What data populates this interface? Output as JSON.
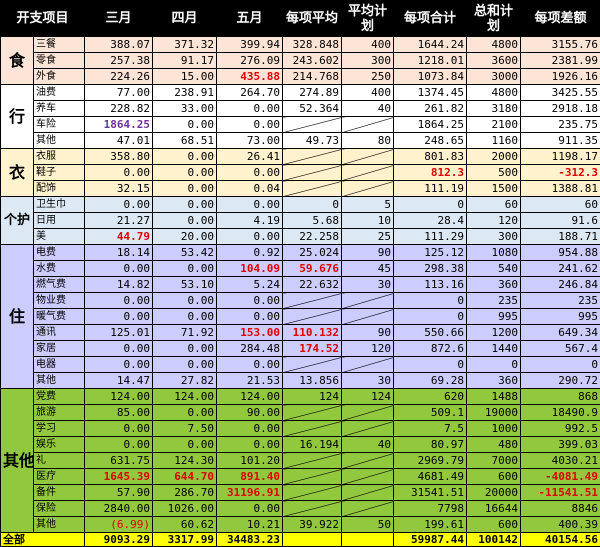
{
  "headers": {
    "category": "开支项目",
    "march": "三月",
    "april": "四月",
    "may": "五月",
    "per_avg": "每项平均",
    "avg_plan": "平均计划",
    "per_total": "每项合计",
    "sum_plan": "总和计划",
    "per_diff": "每项差额"
  },
  "colors": {
    "header_bg": "#000000",
    "food": "#fce4d6",
    "transport": "#ffffff",
    "clothing": "#fff2cc",
    "personal_care": "#dde8f5",
    "housing": "#ccccff",
    "other": "#92c83e",
    "total": "#ffff00",
    "negative_red": "#e00000",
    "purple": "#7030a0"
  },
  "groups": [
    {
      "category": "食",
      "color": "#fce4d6",
      "rows": [
        {
          "item": "三餐",
          "m3": "388.07",
          "m4": "371.32",
          "m5": "399.94",
          "avg": "328.848",
          "avg_plan": "400",
          "total": "1644.24",
          "plan": "4800",
          "diff": "3155.76"
        },
        {
          "item": "零食",
          "m3": "257.38",
          "m4": "91.17",
          "m5": "276.09",
          "avg": "243.602",
          "avg_plan": "300",
          "total": "1218.01",
          "plan": "3600",
          "diff": "2381.99"
        },
        {
          "item": "外食",
          "m3": "224.26",
          "m4": "15.00",
          "m5": "435.88",
          "avg": "214.768",
          "avg_plan": "250",
          "total": "1073.84",
          "plan": "3000",
          "diff": "1926.16",
          "red": [
            "m5"
          ]
        }
      ]
    },
    {
      "category": "行",
      "color": "#ffffff",
      "rows": [
        {
          "item": "油费",
          "m3": "77.00",
          "m4": "238.91",
          "m5": "264.70",
          "avg": "274.89",
          "avg_plan": "400",
          "total": "1374.45",
          "plan": "4800",
          "diff": "3425.55"
        },
        {
          "item": "养车",
          "m3": "228.82",
          "m4": "33.00",
          "m5": "0.00",
          "avg": "52.364",
          "avg_plan": "40",
          "total": "261.82",
          "plan": "3180",
          "diff": "2918.18"
        },
        {
          "item": "车险",
          "m3": "1864.25",
          "m4": "0.00",
          "m5": "0.00",
          "avg": "",
          "avg_plan": "",
          "total": "1864.25",
          "plan": "2100",
          "diff": "235.75",
          "purple": [
            "m3"
          ],
          "slash": [
            "avg",
            "avg_plan"
          ]
        },
        {
          "item": "其他",
          "m3": "47.01",
          "m4": "68.51",
          "m5": "73.00",
          "avg": "49.73",
          "avg_plan": "80",
          "total": "248.65",
          "plan": "1160",
          "diff": "911.35"
        }
      ]
    },
    {
      "category": "衣",
      "color": "#fff2cc",
      "rows": [
        {
          "item": "衣服",
          "m3": "358.80",
          "m4": "0.00",
          "m5": "26.41",
          "avg": "",
          "avg_plan": "",
          "total": "801.83",
          "plan": "2000",
          "diff": "1198.17",
          "slash": [
            "avg",
            "avg_plan"
          ]
        },
        {
          "item": "鞋子",
          "m3": "0.00",
          "m4": "0.00",
          "m5": "0.00",
          "avg": "",
          "avg_plan": "",
          "total": "812.3",
          "plan": "500",
          "diff": "-312.3",
          "red": [
            "total",
            "diff"
          ],
          "slash": [
            "avg",
            "avg_plan"
          ]
        },
        {
          "item": "配饰",
          "m3": "32.15",
          "m4": "0.00",
          "m5": "0.04",
          "avg": "",
          "avg_plan": "",
          "total": "111.19",
          "plan": "1500",
          "diff": "1388.81",
          "slash": [
            "avg",
            "avg_plan"
          ]
        }
      ]
    },
    {
      "category": "个护",
      "color": "#dde8f5",
      "rows": [
        {
          "item": "卫生巾",
          "m3": "0.00",
          "m4": "0.00",
          "m5": "0.00",
          "avg": "0",
          "avg_plan": "5",
          "total": "0",
          "plan": "60",
          "diff": "60"
        },
        {
          "item": "日用",
          "m3": "21.27",
          "m4": "0.00",
          "m5": "4.19",
          "avg": "5.68",
          "avg_plan": "10",
          "total": "28.4",
          "plan": "120",
          "diff": "91.6"
        },
        {
          "item": "美",
          "m3": "44.79",
          "m4": "20.00",
          "m5": "0.00",
          "avg": "22.258",
          "avg_plan": "25",
          "total": "111.29",
          "plan": "300",
          "diff": "188.71",
          "red": [
            "m3"
          ]
        }
      ]
    },
    {
      "category": "住",
      "color": "#ccccff",
      "rows": [
        {
          "item": "电费",
          "m3": "18.14",
          "m4": "53.42",
          "m5": "0.92",
          "avg": "25.024",
          "avg_plan": "90",
          "total": "125.12",
          "plan": "1080",
          "diff": "954.88"
        },
        {
          "item": "水费",
          "m3": "0.00",
          "m4": "0.00",
          "m5": "104.09",
          "avg": "59.676",
          "avg_plan": "45",
          "total": "298.38",
          "plan": "540",
          "diff": "241.62",
          "red": [
            "m5",
            "avg"
          ]
        },
        {
          "item": "燃气费",
          "m3": "14.82",
          "m4": "53.10",
          "m5": "5.24",
          "avg": "22.632",
          "avg_plan": "30",
          "total": "113.16",
          "plan": "360",
          "diff": "246.84"
        },
        {
          "item": "物业费",
          "m3": "0.00",
          "m4": "0.00",
          "m5": "0.00",
          "avg": "",
          "avg_plan": "",
          "total": "0",
          "plan": "235",
          "diff": "235",
          "slash": [
            "avg",
            "avg_plan"
          ]
        },
        {
          "item": "暖气费",
          "m3": "0.00",
          "m4": "0.00",
          "m5": "0.00",
          "avg": "",
          "avg_plan": "",
          "total": "0",
          "plan": "995",
          "diff": "995",
          "slash": [
            "avg",
            "avg_plan"
          ]
        },
        {
          "item": "通讯",
          "m3": "125.01",
          "m4": "71.92",
          "m5": "153.00",
          "avg": "110.132",
          "avg_plan": "90",
          "total": "550.66",
          "plan": "1200",
          "diff": "649.34",
          "red": [
            "m5",
            "avg"
          ]
        },
        {
          "item": "家居",
          "m3": "0.00",
          "m4": "0.00",
          "m5": "284.48",
          "avg": "174.52",
          "avg_plan": "120",
          "total": "872.6",
          "plan": "1440",
          "diff": "567.4",
          "red": [
            "avg"
          ]
        },
        {
          "item": "电器",
          "m3": "0.00",
          "m4": "0.00",
          "m5": "0.00",
          "avg": "",
          "avg_plan": "",
          "total": "0",
          "plan": "0",
          "diff": "0",
          "slash": [
            "avg",
            "avg_plan"
          ]
        },
        {
          "item": "其他",
          "m3": "14.47",
          "m4": "27.82",
          "m5": "21.53",
          "avg": "13.856",
          "avg_plan": "30",
          "total": "69.28",
          "plan": "360",
          "diff": "290.72"
        }
      ]
    },
    {
      "category": "其他",
      "color": "#92c83e",
      "rows": [
        {
          "item": "党费",
          "m3": "124.00",
          "m4": "124.00",
          "m5": "124.00",
          "avg": "124",
          "avg_plan": "124",
          "total": "620",
          "plan": "1488",
          "diff": "868"
        },
        {
          "item": "旅游",
          "m3": "85.00",
          "m4": "0.00",
          "m5": "90.00",
          "avg": "",
          "avg_plan": "",
          "total": "509.1",
          "plan": "19000",
          "diff": "18490.9",
          "slash": [
            "avg",
            "avg_plan"
          ]
        },
        {
          "item": "学习",
          "m3": "0.00",
          "m4": "7.50",
          "m5": "0.00",
          "avg": "",
          "avg_plan": "",
          "total": "7.5",
          "plan": "1000",
          "diff": "992.5",
          "slash": [
            "avg",
            "avg_plan"
          ]
        },
        {
          "item": "娱乐",
          "m3": "0.00",
          "m4": "0.00",
          "m5": "0.00",
          "avg": "16.194",
          "avg_plan": "40",
          "total": "80.97",
          "plan": "480",
          "diff": "399.03"
        },
        {
          "item": "礼",
          "m3": "631.75",
          "m4": "124.30",
          "m5": "101.20",
          "avg": "",
          "avg_plan": "",
          "total": "2969.79",
          "plan": "7000",
          "diff": "4030.21",
          "slash": [
            "avg",
            "avg_plan"
          ]
        },
        {
          "item": "医疗",
          "m3": "1645.39",
          "m4": "644.70",
          "m5": "891.40",
          "avg": "",
          "avg_plan": "",
          "total": "4681.49",
          "plan": "600",
          "diff": "-4081.49",
          "red": [
            "m3",
            "m4",
            "m5",
            "diff"
          ],
          "slash": [
            "avg",
            "avg_plan"
          ]
        },
        {
          "item": "备件",
          "m3": "57.90",
          "m4": "286.70",
          "m5": "31196.91",
          "avg": "",
          "avg_plan": "",
          "total": "31541.51",
          "plan": "20000",
          "diff": "-11541.51",
          "red": [
            "m5",
            "diff"
          ],
          "slash": [
            "avg",
            "avg_plan"
          ]
        },
        {
          "item": "保险",
          "m3": "2840.00",
          "m4": "1026.00",
          "m5": "0.00",
          "avg": "",
          "avg_plan": "",
          "total": "7798",
          "plan": "16644",
          "diff": "8846",
          "slash": [
            "avg",
            "avg_plan"
          ]
        },
        {
          "item": "其他",
          "m3": "(6.99)",
          "m4": "60.62",
          "m5": "10.21",
          "avg": "39.922",
          "avg_plan": "50",
          "total": "199.61",
          "plan": "600",
          "diff": "400.39",
          "redplain": [
            "m3"
          ]
        }
      ]
    }
  ],
  "total_row": {
    "label": "全部",
    "m3": "9093.29",
    "m4": "3317.99",
    "m5": "34483.23",
    "total": "59987.44",
    "plan": "100142",
    "diff": "40154.56"
  }
}
